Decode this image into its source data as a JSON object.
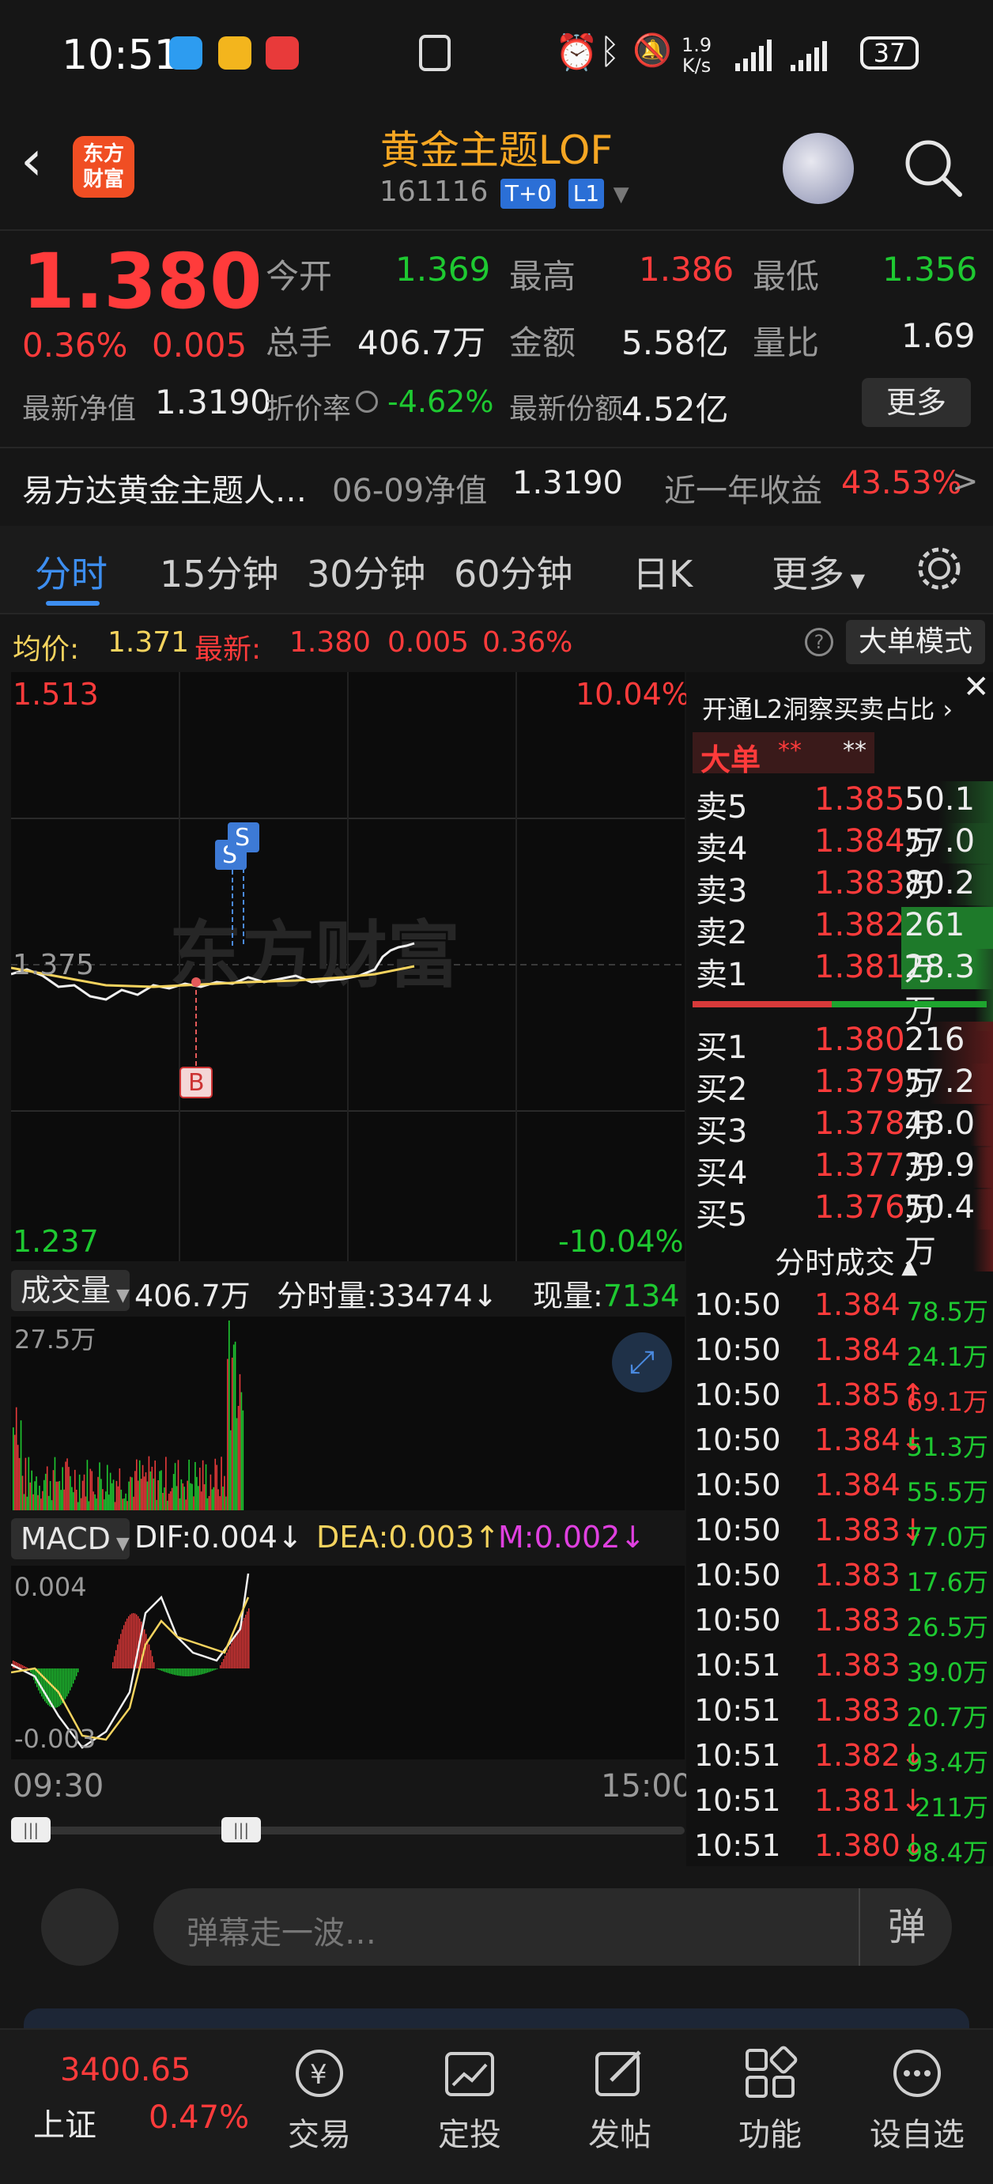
{
  "status": {
    "time": "10:51",
    "speed_top": "1.9",
    "speed_unit": "K/s",
    "battery": "37"
  },
  "header": {
    "title": "黄金主题LOF",
    "code": "161116",
    "tag1": "T+0",
    "tag2": "L1",
    "logo_l1": "东方",
    "logo_l2": "财富"
  },
  "quote": {
    "price": "1.380",
    "pct": "0.36%",
    "chg": "0.005",
    "open_label": "今开",
    "open": "1.369",
    "high_label": "最高",
    "high": "1.386",
    "low_label": "最低",
    "low": "1.356",
    "vol_label": "总手",
    "vol": "406.7万",
    "amount_label": "金额",
    "amount": "5.58亿",
    "ratio_label": "量比",
    "ratio": "1.69",
    "nav_label": "最新净值",
    "nav": "1.3190",
    "discount_label": "折价率",
    "discount": "-4.62%",
    "shares_label": "最新份额",
    "shares": "4.52亿",
    "more": "更多"
  },
  "fund": {
    "name": "易方达黄金主题人…",
    "nav_date": "06-09净值",
    "nav": "1.3190",
    "yr_label": "近一年收益",
    "yr": "43.53%",
    "arrow": ">"
  },
  "tabs": [
    "分时",
    "15分钟",
    "30分钟",
    "60分钟",
    "日K",
    "更多"
  ],
  "info_bar": {
    "avg_label": "均价:",
    "avg": "1.371",
    "last_label": "最新:",
    "last": "1.380",
    "chg": "0.005",
    "pct": "0.36%",
    "mode": "大单模式"
  },
  "chart": {
    "y_top": "1.513",
    "y_bottom": "1.237",
    "pct_top": "10.04%",
    "pct_bottom": "-10.04%",
    "mid": "1.375",
    "watermark": "东方财富",
    "buy_mark": "B",
    "sell_mark": "S",
    "time_start": "09:30",
    "time_end": "15:00"
  },
  "vol_bar": {
    "label": "成交量",
    "total": "406.7万",
    "interval_label": "分时量:",
    "interval": "33474",
    "now_label": "现量:",
    "now": "7134",
    "y_top": "27.5万"
  },
  "macd_bar": {
    "label": "MACD",
    "dif": "DIF:0.004",
    "dea": "DEA:0.003",
    "m": "M:0.002",
    "y_top": "0.004",
    "y_bottom": "-0.003"
  },
  "side": {
    "l2": "开通L2洞察买卖占比",
    "big_label": "大单",
    "stars1": "**",
    "stars2": "**",
    "sells": [
      {
        "label": "卖5",
        "price": "1.385",
        "vol": "50.1万"
      },
      {
        "label": "卖4",
        "price": "1.384",
        "vol": "57.0万"
      },
      {
        "label": "卖3",
        "price": "1.383",
        "vol": "80.2万"
      },
      {
        "label": "卖2",
        "price": "1.382",
        "vol": "261万"
      },
      {
        "label": "卖1",
        "price": "1.381",
        "vol": "28.3万"
      }
    ],
    "buys": [
      {
        "label": "买1",
        "price": "1.380",
        "vol": "216万"
      },
      {
        "label": "买2",
        "price": "1.379",
        "vol": "57.2万"
      },
      {
        "label": "买3",
        "price": "1.378",
        "vol": "48.0万"
      },
      {
        "label": "买4",
        "price": "1.377",
        "vol": "39.9万"
      },
      {
        "label": "买5",
        "price": "1.376",
        "vol": "50.4万"
      }
    ],
    "deals_title": "分时成交",
    "deals": [
      {
        "t": "10:50",
        "p": "1.384",
        "v": "78.5万",
        "c": "green"
      },
      {
        "t": "10:50",
        "p": "1.384",
        "v": "24.1万",
        "c": "green"
      },
      {
        "t": "10:50",
        "p": "1.385↑",
        "v": "69.1万",
        "c": "red"
      },
      {
        "t": "10:50",
        "p": "1.384↓",
        "v": "51.3万",
        "c": "green"
      },
      {
        "t": "10:50",
        "p": "1.384",
        "v": "55.5万",
        "c": "green"
      },
      {
        "t": "10:50",
        "p": "1.383↓",
        "v": "77.0万",
        "c": "green"
      },
      {
        "t": "10:50",
        "p": "1.383",
        "v": "17.6万",
        "c": "green"
      },
      {
        "t": "10:50",
        "p": "1.383",
        "v": "26.5万",
        "c": "green"
      },
      {
        "t": "10:51",
        "p": "1.383",
        "v": "39.0万",
        "c": "green"
      },
      {
        "t": "10:51",
        "p": "1.383",
        "v": "20.7万",
        "c": "green"
      },
      {
        "t": "10:51",
        "p": "1.382↓",
        "v": "93.4万",
        "c": "green"
      },
      {
        "t": "10:51",
        "p": "1.381↓",
        "v": "211万",
        "c": "green"
      },
      {
        "t": "10:51",
        "p": "1.380↓",
        "v": "98.4万",
        "c": "green"
      }
    ]
  },
  "danmu": {
    "placeholder": "弹幕走一波…",
    "btn": "弹"
  },
  "nav": {
    "index_val": "3400.65",
    "index_name": "上证",
    "index_pct": "0.47%",
    "items": [
      "交易",
      "定投",
      "发帖",
      "功能",
      "设自选"
    ]
  }
}
